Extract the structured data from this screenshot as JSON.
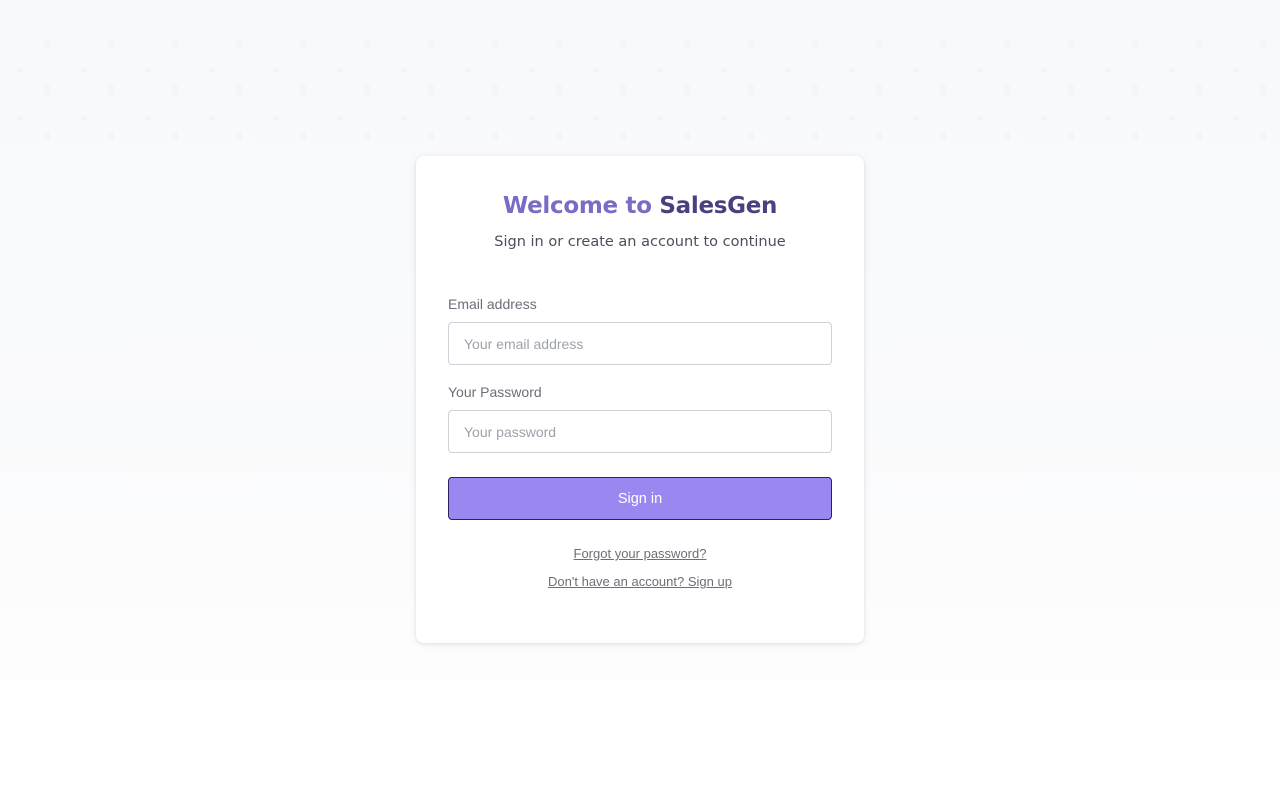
{
  "login": {
    "title_part1": "Welcome to ",
    "title_part2": "SalesGen",
    "subtitle": "Sign in or create an account to continue",
    "email": {
      "label": "Email address",
      "placeholder": "Your email address",
      "value": ""
    },
    "password": {
      "label": "Your Password",
      "placeholder": "Your password",
      "value": ""
    },
    "submit_label": "Sign in",
    "forgot_link": "Forgot your password?",
    "signup_link": "Don't have an account? Sign up"
  },
  "colors": {
    "title_primary": "#7c6bc4",
    "title_secondary": "#4b3f7e",
    "button_bg": "#9b87f0",
    "button_border": "#2a2360"
  }
}
